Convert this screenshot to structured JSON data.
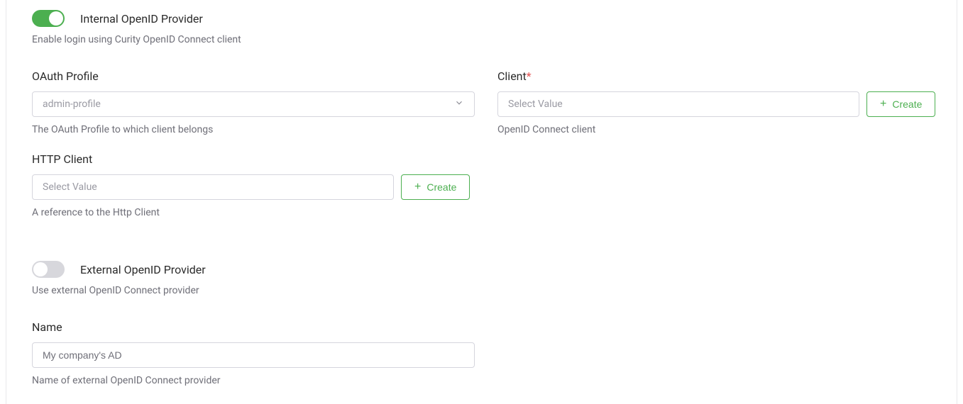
{
  "internal": {
    "toggle_label": "Internal OpenID Provider",
    "desc": "Enable login using Curity OpenID Connect client"
  },
  "oauth": {
    "label": "OAuth Profile",
    "value": "admin-profile",
    "help": "The OAuth Profile to which client belongs"
  },
  "client": {
    "label": "Client",
    "placeholder": "Select Value",
    "help": "OpenID Connect client",
    "create": "Create"
  },
  "http": {
    "label": "HTTP Client",
    "placeholder": "Select Value",
    "help": "A reference to the Http Client",
    "create": "Create"
  },
  "external": {
    "toggle_label": "External OpenID Provider",
    "desc": "Use external OpenID Connect provider"
  },
  "name": {
    "label": "Name",
    "value": "My company's AD",
    "help": "Name of external OpenID Connect provider"
  }
}
